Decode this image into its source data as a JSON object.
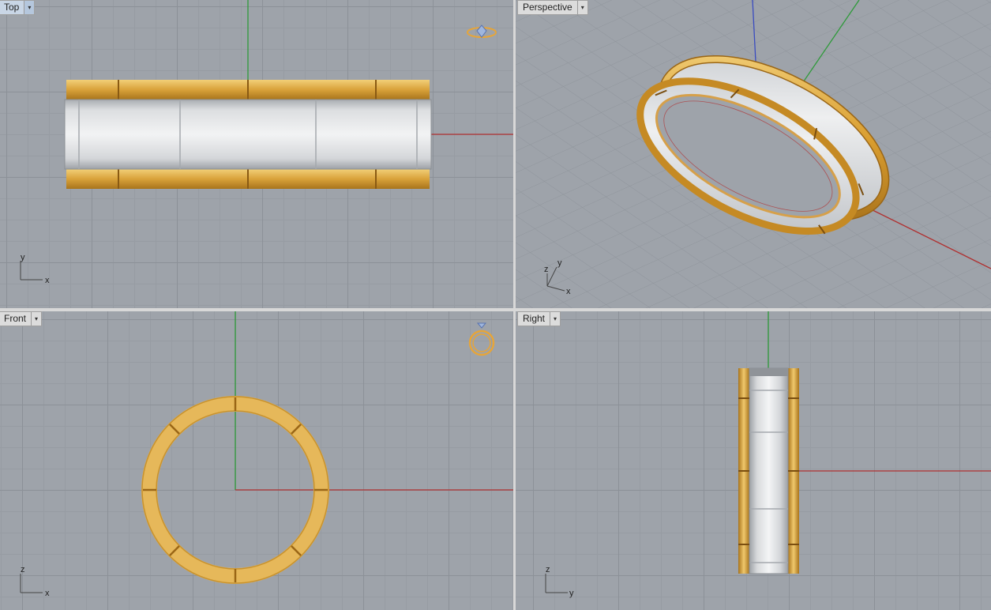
{
  "viewports": {
    "top": {
      "label": "Top",
      "axis_h": "x",
      "axis_v": "y"
    },
    "perspective": {
      "label": "Perspective",
      "axis_x": "x",
      "axis_y": "y",
      "axis_z": "z"
    },
    "front": {
      "label": "Front",
      "axis_h": "x",
      "axis_v": "z"
    },
    "right": {
      "label": "Right",
      "axis_h": "y",
      "axis_v": "z"
    }
  },
  "dropdown_glyph": "▾",
  "colors": {
    "viewport_bg": "#9ea3aa",
    "grid_major": "#8c9198",
    "grid_minor": "#979ca3",
    "x_axis": "#b03030",
    "y_axis": "#2e9a3a",
    "z_axis": "#3a4cc0",
    "gold": "#e0a93c",
    "silver": "#d7d9dc",
    "active_label": "#c9d6e6"
  },
  "icons": {
    "ring_gizmo_top": "ring-gem-icon",
    "ring_gizmo_front": "ring-gem-icon"
  }
}
